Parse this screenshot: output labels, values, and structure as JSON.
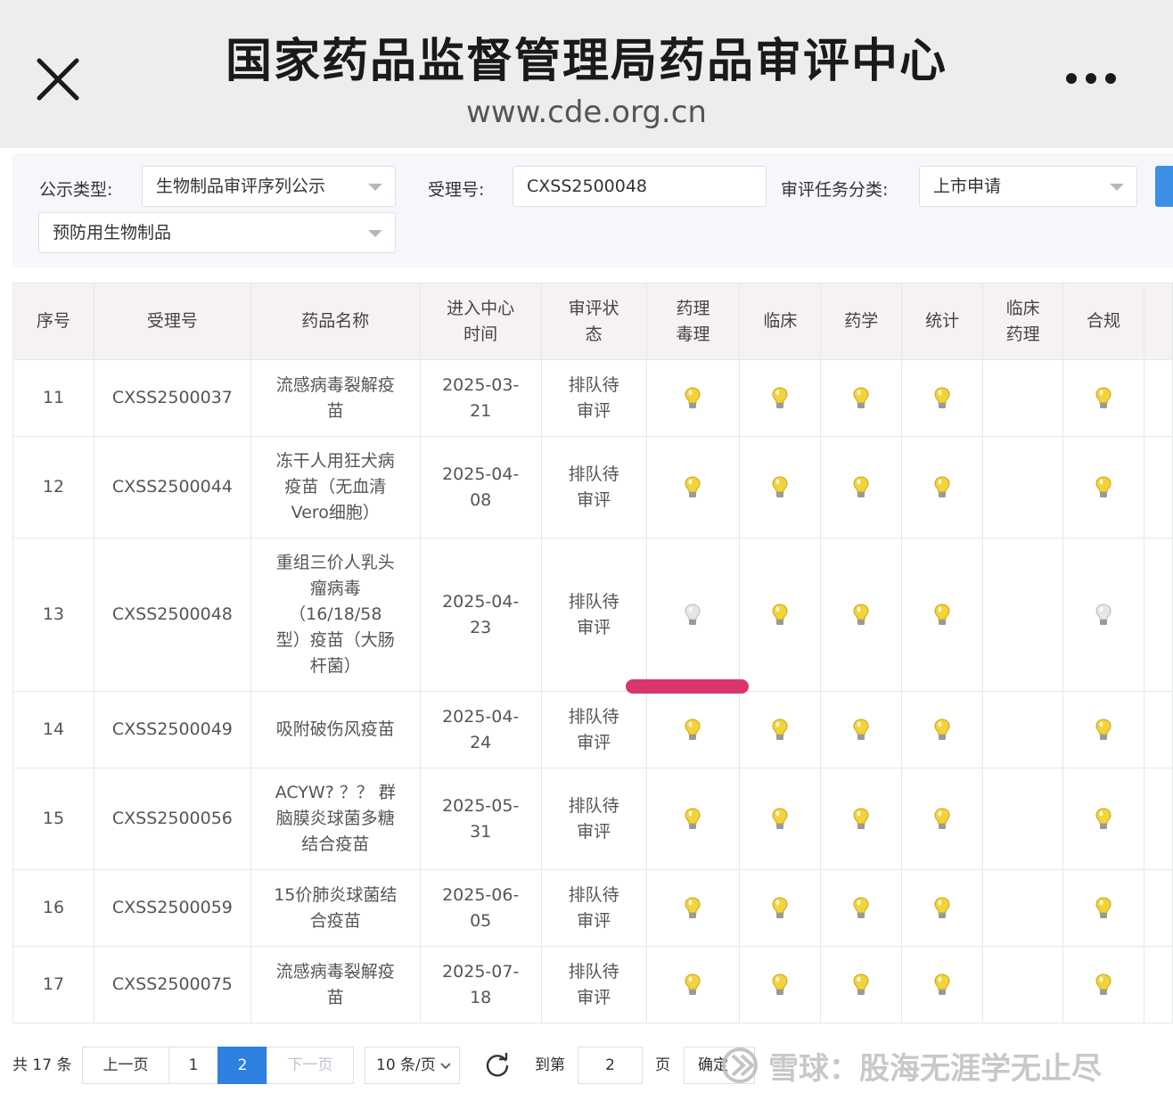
{
  "browser": {
    "title": "国家药品监督管理局药品审评中心",
    "url": "www.cde.org.cn"
  },
  "filters": {
    "announcement_type_label": "公示类型:",
    "announcement_type_value": "生物制品审评序列公示",
    "acceptance_no_label": "受理号:",
    "acceptance_no_value": "CXSS2500048",
    "task_category_label": "审评任务分类:",
    "task_category_value": "上市申请",
    "product_class_value": "预防用生物制品"
  },
  "table": {
    "headers": [
      "序号",
      "受理号",
      "药品名称",
      "进入中心时间",
      "审评状态",
      "药理毒理",
      "临床",
      "药学",
      "统计",
      "临床药理",
      "合规"
    ],
    "header_lines": [
      [
        "序号"
      ],
      [
        "受理号"
      ],
      [
        "药品名称"
      ],
      [
        "进入中心",
        "时间"
      ],
      [
        "审评状",
        "态"
      ],
      [
        "药理",
        "毒理"
      ],
      [
        "临床"
      ],
      [
        "药学"
      ],
      [
        "统计"
      ],
      [
        "临床",
        "药理"
      ],
      [
        "合规"
      ]
    ],
    "rows": [
      {
        "no": "11",
        "code": "CXSS2500037",
        "name_lines": [
          "流感病毒裂解疫",
          "苗"
        ],
        "date_lines": [
          "2025-03-",
          "21"
        ],
        "status_lines": [
          "排队待",
          "审评"
        ],
        "lights": [
          "on",
          "on",
          "on",
          "on",
          "none",
          "on"
        ],
        "highlight": false
      },
      {
        "no": "12",
        "code": "CXSS2500044",
        "name_lines": [
          "冻干人用狂犬病",
          "疫苗（无血清",
          "Vero细胞）"
        ],
        "date_lines": [
          "2025-04-",
          "08"
        ],
        "status_lines": [
          "排队待",
          "审评"
        ],
        "lights": [
          "on",
          "on",
          "on",
          "on",
          "none",
          "on"
        ],
        "highlight": false
      },
      {
        "no": "13",
        "code": "CXSS2500048",
        "name_lines": [
          "重组三价人乳头",
          "瘤病毒",
          "（16/18/58",
          "型）疫苗（大肠",
          "杆菌）"
        ],
        "date_lines": [
          "2025-04-",
          "23"
        ],
        "status_lines": [
          "排队待",
          "审评"
        ],
        "lights": [
          "off",
          "on",
          "on",
          "on",
          "none",
          "off"
        ],
        "highlight": true
      },
      {
        "no": "14",
        "code": "CXSS2500049",
        "name_lines": [
          "吸附破伤风疫苗"
        ],
        "date_lines": [
          "2025-04-",
          "24"
        ],
        "status_lines": [
          "排队待",
          "审评"
        ],
        "lights": [
          "on",
          "on",
          "on",
          "on",
          "none",
          "on"
        ],
        "highlight": false
      },
      {
        "no": "15",
        "code": "CXSS2500056",
        "name_lines": [
          "ACYW? ？？ 群",
          "脑膜炎球菌多糖",
          "结合疫苗"
        ],
        "date_lines": [
          "2025-05-",
          "31"
        ],
        "status_lines": [
          "排队待",
          "审评"
        ],
        "lights": [
          "on",
          "on",
          "on",
          "on",
          "none",
          "on"
        ],
        "highlight": false
      },
      {
        "no": "16",
        "code": "CXSS2500059",
        "name_lines": [
          "15价肺炎球菌结",
          "合疫苗"
        ],
        "date_lines": [
          "2025-06-",
          "05"
        ],
        "status_lines": [
          "排队待",
          "审评"
        ],
        "lights": [
          "on",
          "on",
          "on",
          "on",
          "none",
          "on"
        ],
        "highlight": false
      },
      {
        "no": "17",
        "code": "CXSS2500075",
        "name_lines": [
          "流感病毒裂解疫",
          "苗"
        ],
        "date_lines": [
          "2025-07-",
          "18"
        ],
        "status_lines": [
          "排队待",
          "审评"
        ],
        "lights": [
          "on",
          "on",
          "on",
          "on",
          "none",
          "on"
        ],
        "highlight": false
      }
    ]
  },
  "pagination": {
    "total": "共 17 条",
    "prev": "上一页",
    "pages": [
      "1",
      "2"
    ],
    "current_page": "2",
    "next": "下一页",
    "page_size": "10 条/页",
    "goto_label": "到第",
    "goto_value": "2",
    "page_unit": "页",
    "confirm": "确定"
  },
  "watermark": "雪球：股海无涯学无止尽",
  "colors": {
    "accent": "#3d8ee6",
    "highlight_mark": "#d9356a",
    "highlight_code": "#8b1a1a",
    "bulb_on": "#f3d33a",
    "bulb_off": "#e6e6e6"
  },
  "icons": {
    "close": "close-icon",
    "more": "more-dots-icon",
    "dropdown": "chevron-down-icon",
    "bulb": "lightbulb-icon",
    "refresh": "refresh-icon"
  }
}
